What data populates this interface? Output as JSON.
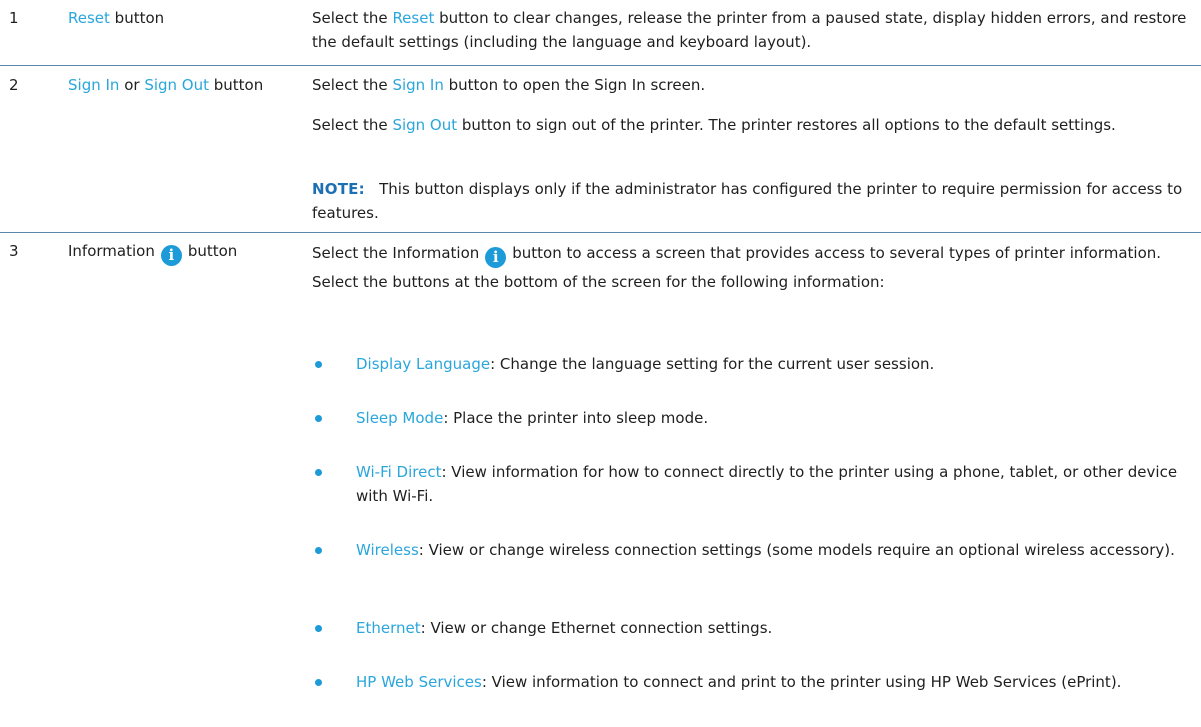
{
  "rows": [
    {
      "number": "1",
      "name_link": "Reset",
      "name_suffix": " button",
      "desc_prefix": "Select the ",
      "desc_link": "Reset",
      "desc_suffix": " button to clear changes, release the printer from a paused state, display hidden errors, and restore the default settings (including the language and keyboard layout)."
    },
    {
      "number": "2",
      "name_link1": "Sign In",
      "name_or": " or ",
      "name_link2": "Sign Out",
      "name_suffix": " button",
      "p1_prefix": "Select the ",
      "p1_link": "Sign In",
      "p1_suffix": " button to open the Sign In screen.",
      "p2_prefix": "Select the ",
      "p2_link": "Sign Out",
      "p2_suffix": " button to sign out of the printer. The printer restores all options to the default settings.",
      "note_label": "NOTE:",
      "note_text": "This button displays only if the administrator has configured the printer to require permission for access to features."
    },
    {
      "number": "3",
      "name_prefix": "Information",
      "name_suffix": "button",
      "icon": "info-icon",
      "desc_prefix": "Select the Information",
      "desc_suffix": "button to access a screen that provides access to several types of printer information. Select the buttons at the bottom of the screen for the following information:",
      "bullets": [
        {
          "link": "Display Language",
          "text": ": Change the language setting for the current user session."
        },
        {
          "link": "Sleep Mode",
          "text": ": Place the printer into sleep mode."
        },
        {
          "link": "Wi-Fi Direct",
          "text": ": View information for how to connect directly to the printer using a phone, tablet, or other device with Wi-Fi."
        },
        {
          "link": "Wireless",
          "text": ": View or change wireless connection settings (some models require an optional wireless accessory)."
        },
        {
          "link": "Ethernet",
          "text": ": View or change Ethernet connection settings."
        },
        {
          "link": "HP Web Services",
          "text": ": View information to connect and print to the printer using HP Web Services (ePrint)."
        }
      ]
    }
  ],
  "colors": {
    "link": "#2aa6dc",
    "note": "#1b6fb3",
    "rule": "#5b87a9",
    "icon": "#1d9ad8"
  }
}
